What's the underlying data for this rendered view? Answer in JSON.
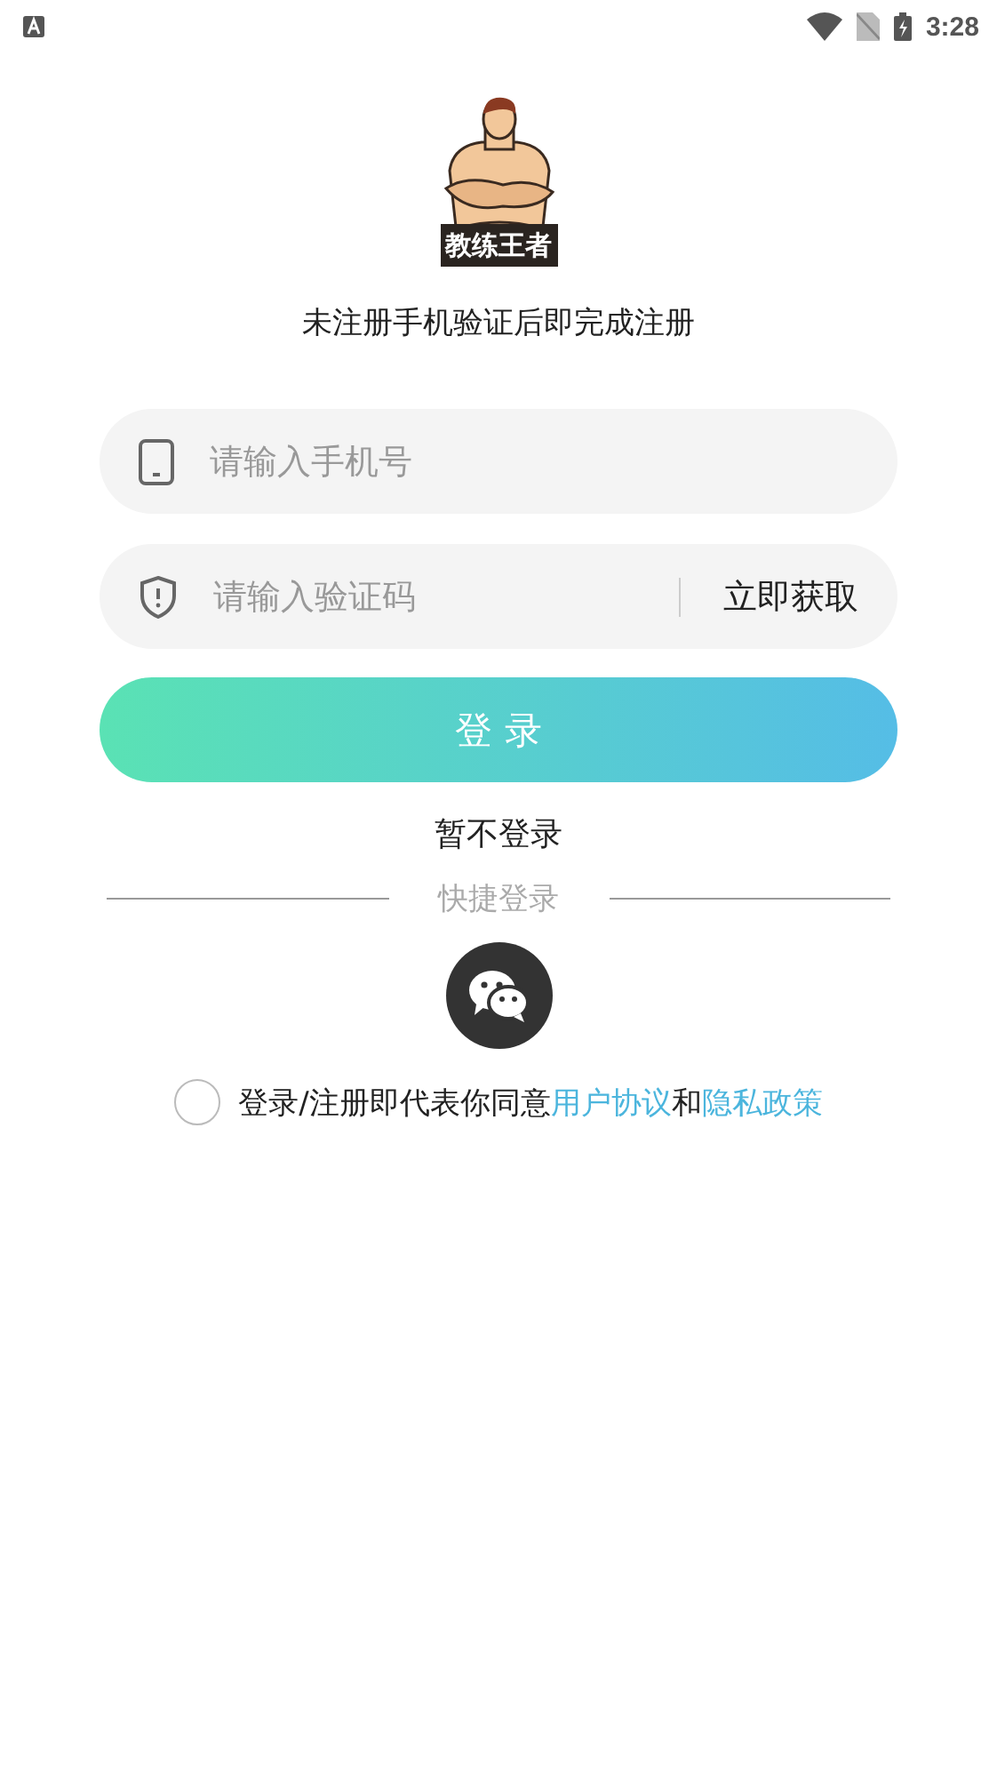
{
  "status_bar": {
    "time": "3:28"
  },
  "logo": {
    "label": "教练王者"
  },
  "subtitle": "未注册手机验证后即完成注册",
  "phone_field": {
    "placeholder": "请输入手机号"
  },
  "code_field": {
    "placeholder": "请输入验证码",
    "action": "立即获取"
  },
  "login_button": {
    "label": "登 录"
  },
  "skip_link": "暂不登录",
  "quick_login": {
    "label": "快捷登录"
  },
  "agreement": {
    "checked": false,
    "parts": [
      {
        "kind": "text",
        "text": "登录/注册即代表你同意"
      },
      {
        "kind": "link",
        "text": "用户协议"
      },
      {
        "kind": "text",
        "text": "和"
      },
      {
        "kind": "link",
        "text": "隐私政策"
      }
    ]
  }
}
